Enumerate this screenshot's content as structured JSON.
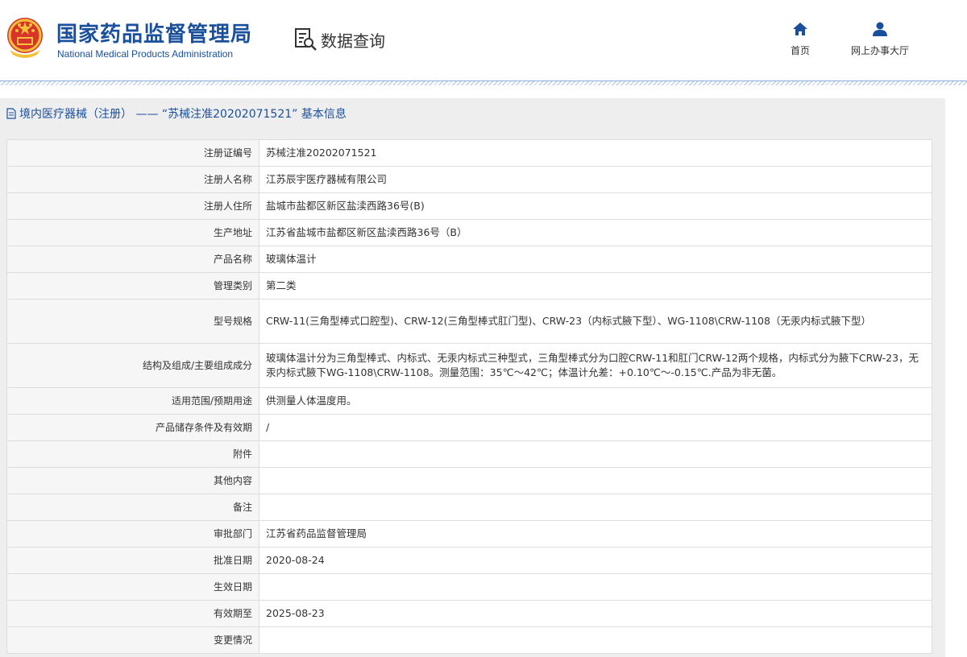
{
  "header": {
    "org_name_cn": "国家药品监督管理局",
    "org_name_en": "National Medical Products Administration",
    "data_query_label": "数据查询",
    "nav": {
      "home_label": "首页",
      "service_hall_label": "网上办事大厅"
    },
    "colors": {
      "brand": "#1a4f9c"
    }
  },
  "page": {
    "title": "境内医疗器械（注册） ——  “苏械注准20202071521” 基本信息"
  },
  "record": {
    "rows": [
      {
        "label": "注册证编号",
        "value": "苏械注准20202071521"
      },
      {
        "label": "注册人名称",
        "value": "江苏辰宇医疗器械有限公司"
      },
      {
        "label": "注册人住所",
        "value": "盐城市盐都区新区盐渎西路36号(B)"
      },
      {
        "label": "生产地址",
        "value": "江苏省盐城市盐都区新区盐渎西路36号（B）"
      },
      {
        "label": "产品名称",
        "value": "玻璃体温计"
      },
      {
        "label": "管理类别",
        "value": "第二类"
      },
      {
        "label": "型号规格",
        "value": "CRW-11(三角型棒式口腔型)、CRW-12(三角型棒式肛门型)、CRW-23（内标式腋下型）、WG-1108\\CRW-1108（无汞内标式腋下型）"
      },
      {
        "label": "结构及组成/主要组成成分",
        "value": "玻璃体温计分为三角型棒式、内标式、无汞内标式三种型式，三角型棒式分为口腔CRW-11和肛门CRW-12两个规格，内标式分为腋下CRW-23，无汞内标式腋下WG-1108\\CRW-1108。测量范围：35℃～42℃；体温计允差：+0.10℃～-0.15℃.产品为非无菌。"
      },
      {
        "label": "适用范围/预期用途",
        "value": "供测量人体温度用。"
      },
      {
        "label": "产品储存条件及有效期",
        "value": "/"
      },
      {
        "label": "附件",
        "value": ""
      },
      {
        "label": "其他内容",
        "value": ""
      },
      {
        "label": "备注",
        "value": ""
      },
      {
        "label": "审批部门",
        "value": "江苏省药品监督管理局"
      },
      {
        "label": "批准日期",
        "value": "2020-08-24"
      },
      {
        "label": "生效日期",
        "value": ""
      },
      {
        "label": "有效期至",
        "value": "2025-08-23"
      },
      {
        "label": "变更情况",
        "value": ""
      }
    ]
  },
  "icons": {
    "emblem": "national-emblem-icon",
    "data_query": "document-search-icon",
    "home": "home-icon",
    "service_hall": "user-icon",
    "title": "document-icon"
  }
}
